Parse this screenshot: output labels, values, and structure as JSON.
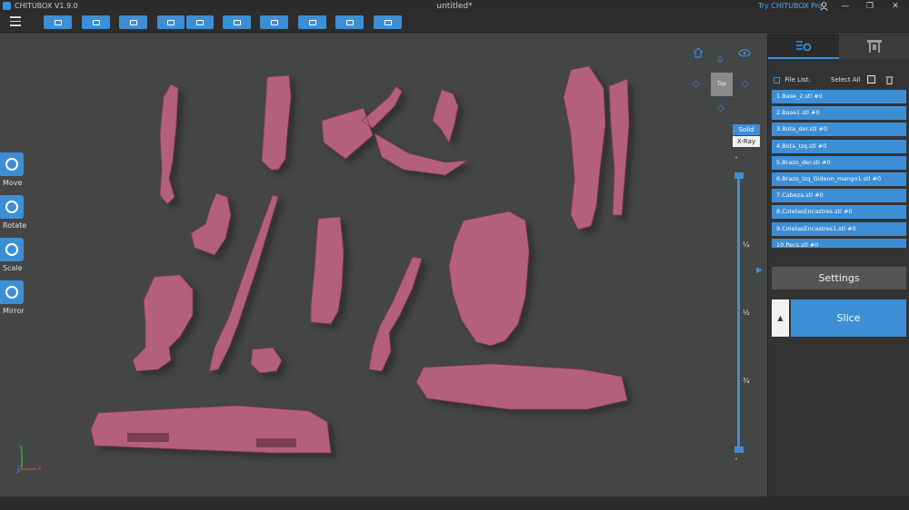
{
  "titlebar": {
    "app_name": "CHITUBOX V1.9.0",
    "document": "untitled*",
    "promo": "Try CHITUBOX Pro",
    "minimize": "—",
    "maximize": "❐",
    "close": "✕"
  },
  "toolbar": {
    "icons": [
      "open-file-icon",
      "save-icon",
      "center-icon",
      "undo-icon",
      "redo-icon",
      "copy-icon",
      "arrange-icon",
      "support-icon",
      "hollow-icon",
      "print-icon"
    ]
  },
  "tools": {
    "move": "Move",
    "rotate": "Rotate",
    "scale": "Scale",
    "mirror": "Mirror"
  },
  "view": {
    "cube_label": "Top",
    "solid": "Solid",
    "xray": "X-Ray"
  },
  "slider": {
    "marks": [
      "¼",
      "½",
      "¾"
    ],
    "up": "˄",
    "down": "˅"
  },
  "axes": {
    "x": "X",
    "y": "Y",
    "z": "Z"
  },
  "panel": {
    "file_list_label": "File List:",
    "select_all_label": "Select All",
    "files": [
      "1.Base_2.stl #0",
      "2.Base1.stl #0",
      "3.Bota_der.stl #0",
      "4.Bota_Izq.stl #0",
      "5.Brazo_der.stl #0",
      "6.Brazo_Izq_Gideon_mango1.stl #0",
      "7.Cabeza.stl #0",
      "8.ColetasEncastres.stl #0",
      "9.ColetasEncastres1.stl #0",
      "10.Pecs.stl #0"
    ],
    "settings": "Settings",
    "slice": "Slice"
  },
  "colors": {
    "accent": "#3d8fd5",
    "model": "#b5607a",
    "viewport": "#444545"
  }
}
